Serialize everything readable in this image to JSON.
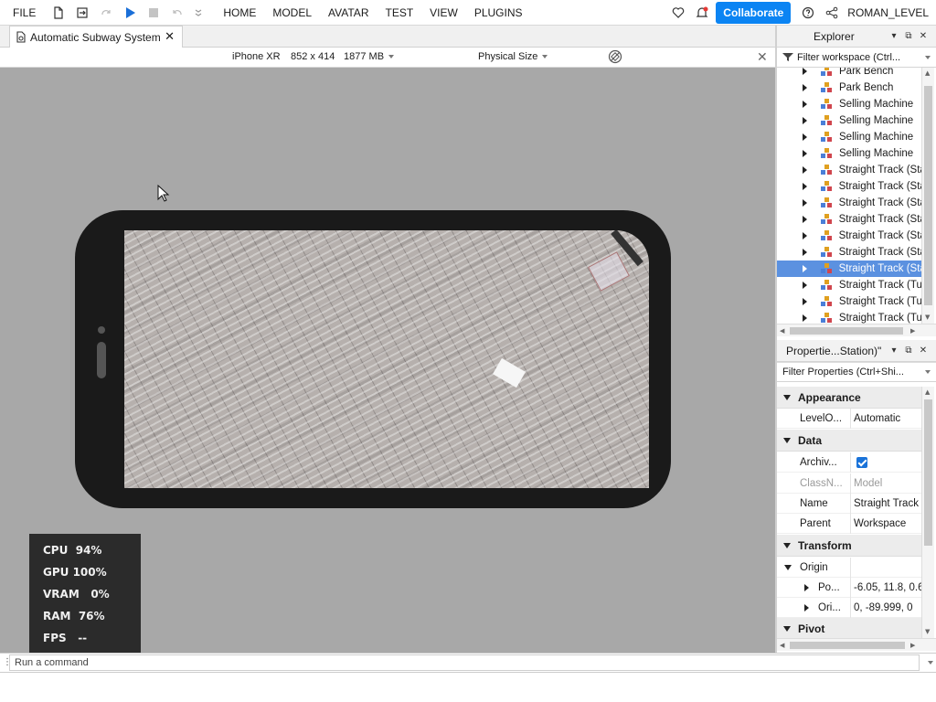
{
  "menu": {
    "file": "FILE",
    "nav": [
      "HOME",
      "MODEL",
      "AVATAR",
      "TEST",
      "VIEW",
      "PLUGINS"
    ],
    "collaborate": "Collaborate",
    "user": "ROMAN_LEVEL"
  },
  "tab": {
    "title": "Automatic Subway System"
  },
  "device": {
    "name": "iPhone XR",
    "resolution": "852 x 414",
    "memory": "1877 MB",
    "size_mode": "Physical Size"
  },
  "stats": [
    {
      "label": "CPU",
      "value": "94%"
    },
    {
      "label": "GPU",
      "value": "100%"
    },
    {
      "label": "VRAM",
      "value": "0%"
    },
    {
      "label": "RAM",
      "value": "76%"
    },
    {
      "label": "FPS",
      "value": "--"
    }
  ],
  "command": {
    "placeholder": "Run a command"
  },
  "explorer": {
    "title": "Explorer",
    "filter": "Filter workspace (Ctrl...",
    "items": [
      {
        "label": "Park Bench",
        "selected": false
      },
      {
        "label": "Park Bench",
        "selected": false
      },
      {
        "label": "Selling Machine",
        "selected": false
      },
      {
        "label": "Selling Machine",
        "selected": false
      },
      {
        "label": "Selling Machine",
        "selected": false
      },
      {
        "label": "Selling Machine",
        "selected": false
      },
      {
        "label": "Straight Track (Sta",
        "selected": false
      },
      {
        "label": "Straight Track (Sta",
        "selected": false
      },
      {
        "label": "Straight Track (Sta",
        "selected": false
      },
      {
        "label": "Straight Track (Sta",
        "selected": false
      },
      {
        "label": "Straight Track (Sta",
        "selected": false
      },
      {
        "label": "Straight Track (Sta",
        "selected": false
      },
      {
        "label": "Straight Track (Sta",
        "selected": true
      },
      {
        "label": "Straight Track (Tu",
        "selected": false
      },
      {
        "label": "Straight Track (Tu",
        "selected": false
      },
      {
        "label": "Straight Track (Tu",
        "selected": false
      }
    ]
  },
  "properties": {
    "title": "Propertie...Station)\"",
    "filter": "Filter Properties (Ctrl+Shi...",
    "sections": {
      "appearance": "Appearance",
      "data": "Data",
      "transform": "Transform",
      "pivot": "Pivot"
    },
    "rows": {
      "level_of_detail": {
        "name": "LevelO...",
        "value": "Automatic"
      },
      "archivable": {
        "name": "Archiv...",
        "checked": true
      },
      "classname": {
        "name": "ClassN...",
        "value": "Model"
      },
      "name": {
        "name": "Name",
        "value": "Straight Track"
      },
      "parent": {
        "name": "Parent",
        "value": "Workspace"
      },
      "origin": {
        "name": "Origin"
      },
      "position": {
        "name": "Po...",
        "value": "-6.05, 11.8, 0.6"
      },
      "orientation": {
        "name": "Ori...",
        "value": "0, -89.999, 0"
      }
    }
  },
  "colors": {
    "accent": "#0b84f3",
    "selection": "#5b91e0",
    "viewport_bg": "#a8a8a8",
    "stats_bg": "#2b2b2b"
  }
}
